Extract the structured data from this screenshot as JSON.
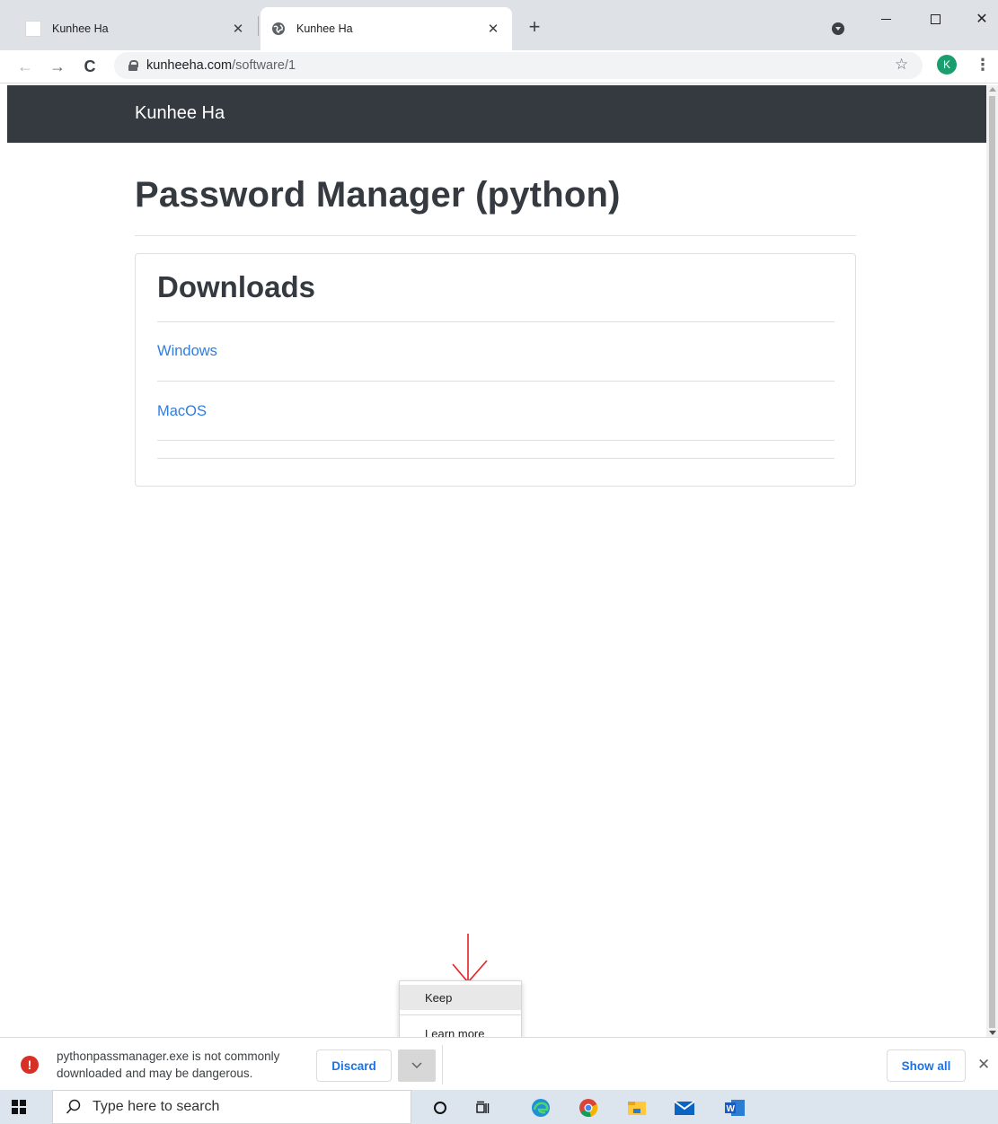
{
  "browser": {
    "tabs": [
      {
        "title": "Kunhee Ha",
        "active": false
      },
      {
        "title": "Kunhee Ha",
        "active": true
      }
    ],
    "url_host": "kunheeha.com",
    "url_path": "/software/1",
    "profile_initial": "K"
  },
  "site": {
    "brand": "Kunhee Ha",
    "page_title": "Password Manager (python)",
    "card_title": "Downloads",
    "links": [
      {
        "label": "Windows"
      },
      {
        "label": "MacOS"
      }
    ]
  },
  "menu": {
    "keep": "Keep",
    "learn_more": "Learn more"
  },
  "download_shelf": {
    "warning_line1": "pythonpassmanager.exe is not commonly",
    "warning_line2": "downloaded and may be dangerous.",
    "discard_label": "Discard",
    "show_all_label": "Show all"
  },
  "taskbar": {
    "search_placeholder": "Type here to search",
    "icons": [
      "cortana-icon",
      "task-view-icon",
      "edge-icon",
      "chrome-icon",
      "file-explorer-icon",
      "mail-icon",
      "word-icon"
    ]
  },
  "colors": {
    "navbar": "#343a40",
    "link": "#2f7de1",
    "warning": "#d93025",
    "annotation_arrow": "#e52222"
  }
}
